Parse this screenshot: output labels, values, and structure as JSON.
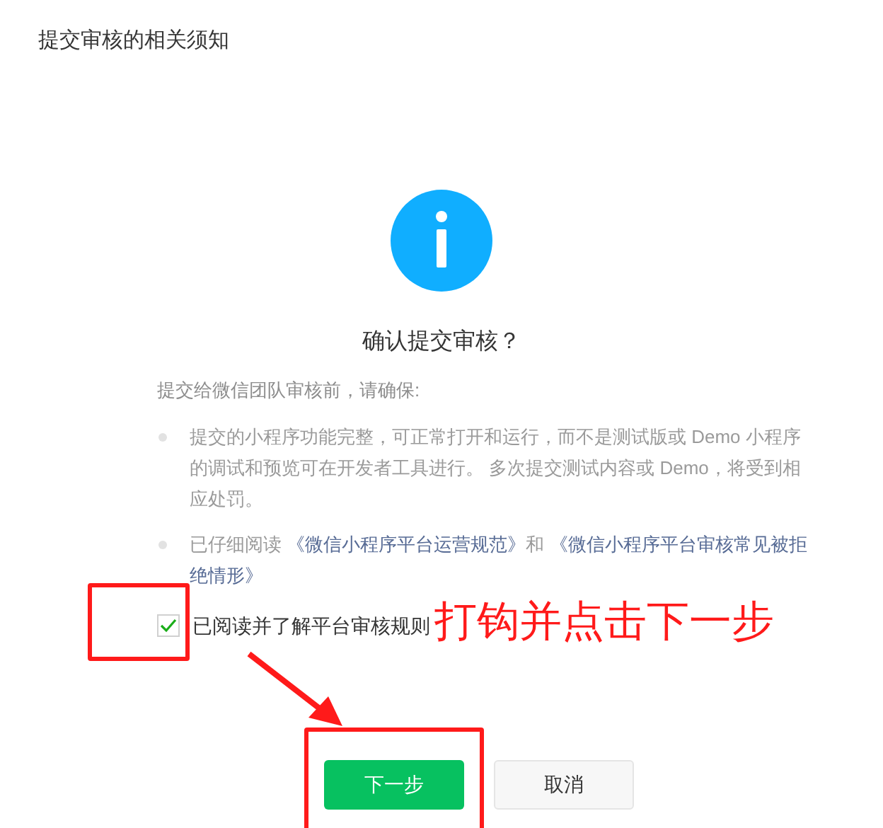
{
  "dialog": {
    "title": "提交审核的相关须知",
    "heading": "确认提交审核？",
    "intro": "提交给微信团队审核前，请确保:",
    "notices": [
      {
        "parts": [
          {
            "kind": "text",
            "text": "提交的小程序功能完整，可正常打开和运行，而不是测试版或 Demo 小程序的调试和预览可在开发者工具进行。 多次提交测试内容或 Demo，将受到相应处罚。"
          }
        ]
      },
      {
        "parts": [
          {
            "kind": "text",
            "text": "已仔细阅读 "
          },
          {
            "kind": "link",
            "text": "《微信小程序平台运营规范》"
          },
          {
            "kind": "text",
            "text": "和 "
          },
          {
            "kind": "link",
            "text": "《微信小程序平台审核常见被拒绝情形》"
          }
        ]
      }
    ],
    "agreement": {
      "label": "已阅读并了解平台审核规则",
      "checked": true
    },
    "buttons": [
      {
        "label": "下一步",
        "kind": "primary"
      },
      {
        "label": "取消",
        "kind": "default"
      }
    ]
  },
  "annotation": {
    "text": "打钩并点击下一步"
  }
}
